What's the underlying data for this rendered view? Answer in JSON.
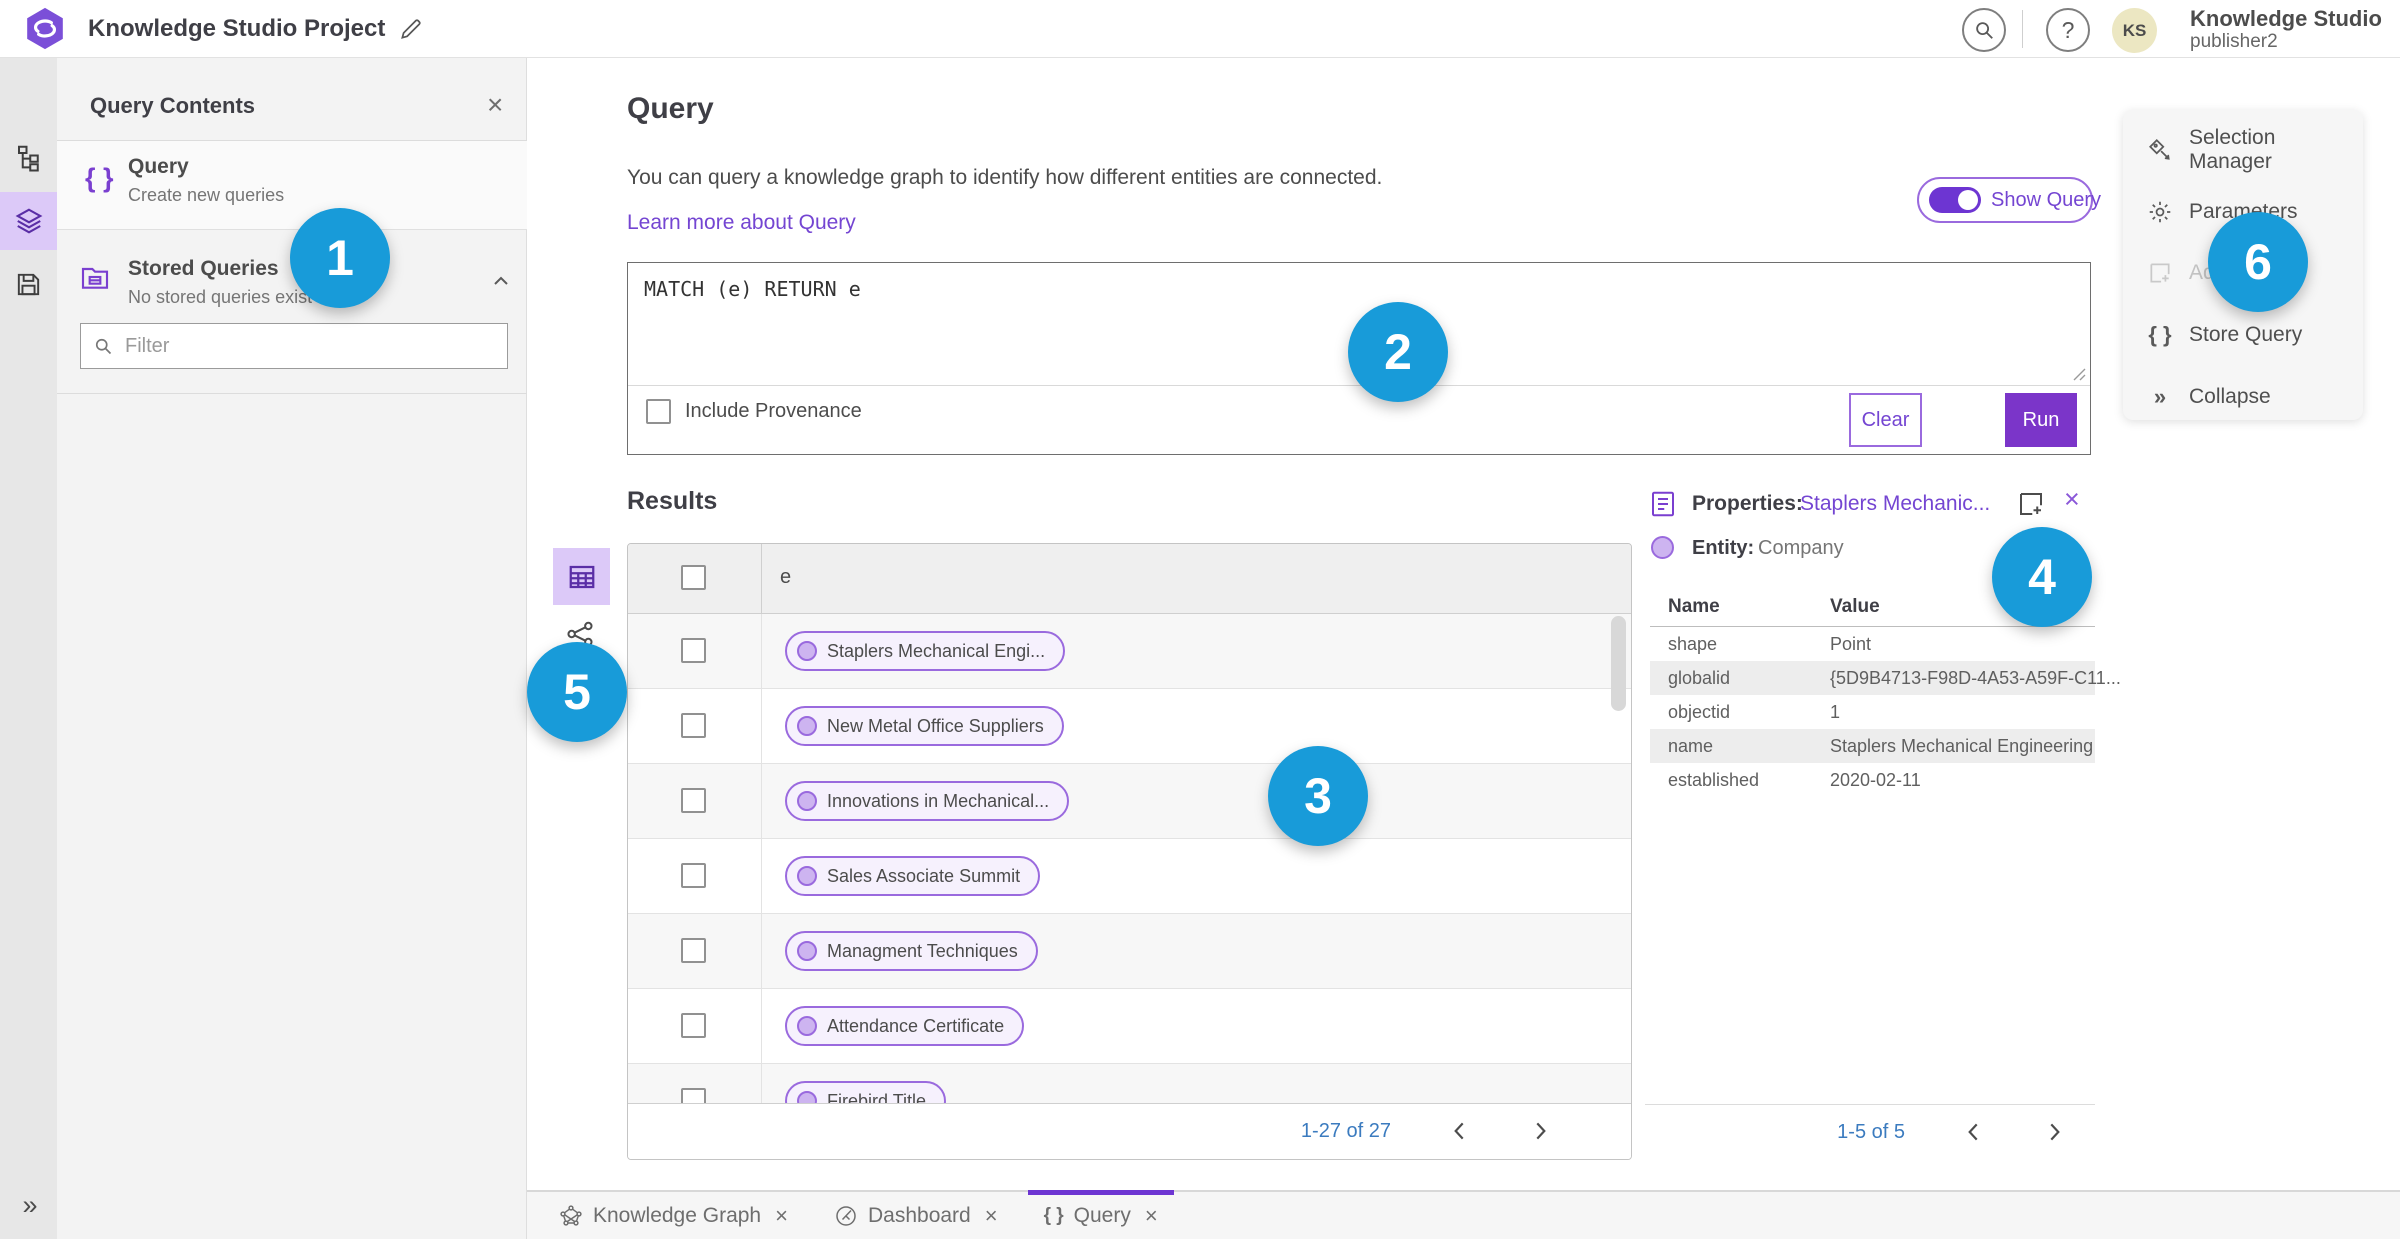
{
  "app": {
    "title": "Knowledge Studio Project"
  },
  "topbar": {
    "user_name": "Knowledge Studio",
    "user_role": "publisher2",
    "avatar_initials": "KS",
    "help_glyph": "?"
  },
  "glyphs": {
    "close": "×",
    "braces": "{ }",
    "collapse": "»",
    "chevron_collapse": "»"
  },
  "left_panel": {
    "title": "Query Contents",
    "query_item": {
      "label": "Query",
      "description": "Create new queries"
    },
    "stored_item": {
      "label": "Stored Queries",
      "description": "No stored queries exist"
    },
    "filter_placeholder": "Filter"
  },
  "query_section": {
    "title": "Query",
    "description": "You can query a knowledge graph to identify how different entities are connected.",
    "learn_more": "Learn more about Query",
    "show_query_label": "Show Query",
    "show_query_enabled": true,
    "query_text": "MATCH (e) RETURN e",
    "include_provenance_label": "Include Provenance",
    "include_provenance_checked": false,
    "clear_label": "Clear",
    "run_label": "Run"
  },
  "results": {
    "title": "Results",
    "column_header": "e",
    "rows": [
      "Staplers Mechanical Engi...",
      "New Metal Office Suppliers",
      "Innovations in Mechanical...",
      "Sales Associate Summit",
      "Managment Techniques",
      "Attendance Certificate",
      "Firebird Title"
    ],
    "pagination": "1-27 of 27"
  },
  "properties": {
    "label": "Properties:",
    "entity_name": "Staplers Mechanic...",
    "entity_label": "Entity:",
    "entity_type": "Company",
    "table": {
      "headers": [
        "Name",
        "Value"
      ],
      "rows": [
        [
          "shape",
          "Point"
        ],
        [
          "globalid",
          "{5D9B4713-F98D-4A53-A59F-C11..."
        ],
        [
          "objectid",
          "1"
        ],
        [
          "name",
          "Staplers Mechanical Engineering"
        ],
        [
          "established",
          "2020-02-11"
        ]
      ]
    },
    "pagination": "1-5 of 5"
  },
  "side_menu": {
    "items": [
      {
        "label": "Selection Manager",
        "disabled": false
      },
      {
        "label": "Parameters",
        "disabled": false
      },
      {
        "label": "Add",
        "disabled": true
      },
      {
        "label": "Store Query",
        "disabled": false
      },
      {
        "label": "Collapse",
        "disabled": false
      }
    ]
  },
  "tabs": [
    {
      "label": "Knowledge Graph",
      "active": false
    },
    {
      "label": "Dashboard",
      "active": false
    },
    {
      "label": "Query",
      "active": true
    }
  ],
  "annotations": [
    {
      "number": "1"
    },
    {
      "number": "2"
    },
    {
      "number": "3"
    },
    {
      "number": "4"
    },
    {
      "number": "5"
    },
    {
      "number": "6"
    }
  ],
  "colors": {
    "accent_purple": "#7b35c9",
    "link_purple": "#7445d2",
    "badge_blue": "#189bd9",
    "selected_lavender": "#dcc9f8",
    "chip_border": "#9a6ade",
    "chip_bg": "#f6f1fd"
  }
}
